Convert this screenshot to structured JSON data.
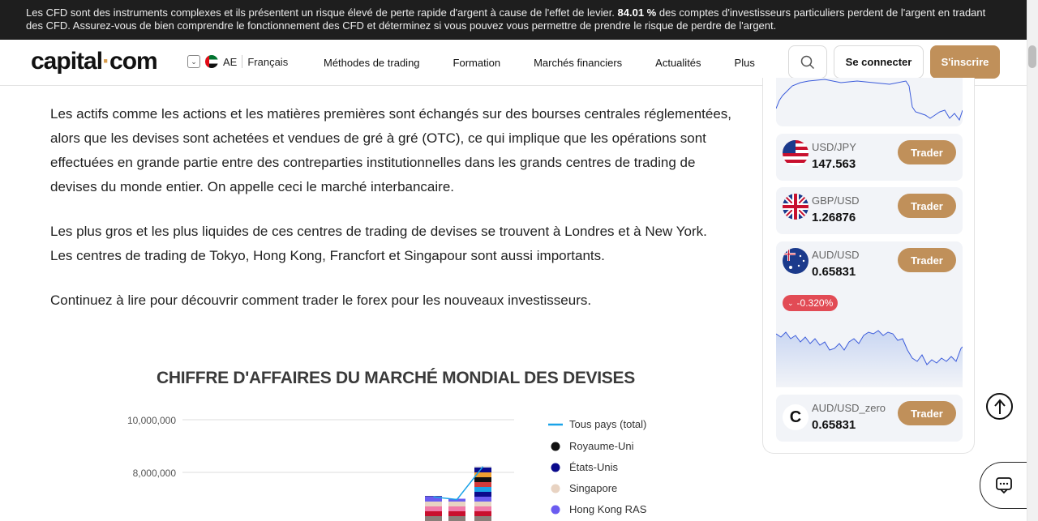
{
  "banner": {
    "text_before": "Les CFD sont des instruments complexes et ils présentent un risque élevé de perte rapide d'argent à cause de l'effet de levier. ",
    "percent": "84.01 %",
    "text_after": " des comptes d'investisseurs particuliers perdent de l'argent en tradant des CFD. Assurez-vous de bien comprendre le fonctionnement des CFD et déterminez si vous pouvez vous permettre de prendre le risque de perdre de l'argent."
  },
  "header": {
    "logo_left": "capital",
    "logo_dot": "·",
    "logo_right": "com",
    "region_code": "AE",
    "language": "Français",
    "nav": [
      "Méthodes de trading",
      "Formation",
      "Marchés financiers",
      "Actualités",
      "Plus"
    ],
    "login_label": "Se connecter",
    "signup_label": "S'inscrire"
  },
  "article": {
    "paragraphs": [
      "Les actifs comme les actions et les matières premières sont échangés sur des bourses centrales réglementées, alors que les devises sont achetées et vendues de gré à gré (OTC), ce qui implique que les opérations sont effectuées en grande partie entre des contreparties institutionnelles dans les grands centres de trading de devises du monde entier. On appelle ceci le marché interbancaire.",
      "Les plus gros et les plus liquides de ces centres de trading de devises se trouvent à Londres et à New York. Les centres de trading de Tokyo, Hong Kong, Francfort et Singapour sont aussi importants.",
      "Continuez à lire pour découvrir comment trader le forex pour les nouveaux investisseurs."
    ]
  },
  "chart_data": {
    "type": "bar",
    "title": "CHIFFRE D'AFFAIRES DU MARCHÉ MONDIAL DES DEVISES",
    "y_ticks": [
      "10,000,000",
      "8,000,000"
    ],
    "legend": [
      {
        "name": "Tous pays (total)",
        "color": "#1aa3e8",
        "kind": "line"
      },
      {
        "name": "Royaume-Uni",
        "color": "#111111",
        "kind": "dot"
      },
      {
        "name": "États-Unis",
        "color": "#0a0a8c",
        "kind": "dot"
      },
      {
        "name": "Singapore",
        "color": "#e8d3c2",
        "kind": "dot"
      },
      {
        "name": "Hong Kong RAS",
        "color": "#6b5cf0",
        "kind": "dot"
      }
    ],
    "visible_bar_tops": [
      7100000,
      7000000,
      8250000
    ]
  },
  "sidebar": {
    "trade_label": "Trader",
    "cards": [
      {
        "pair": "USD/JPY",
        "price": "147.563"
      },
      {
        "pair": "GBP/USD",
        "price": "1.26876"
      },
      {
        "pair": "AUD/USD",
        "price": "0.65831",
        "change": "-0.320%"
      },
      {
        "pair": "AUD/USD_zero",
        "price": "0.65831"
      }
    ]
  },
  "colors": {
    "accent": "#c0905a",
    "negative": "#e24b55",
    "chart_line": "#1aa3e8"
  }
}
